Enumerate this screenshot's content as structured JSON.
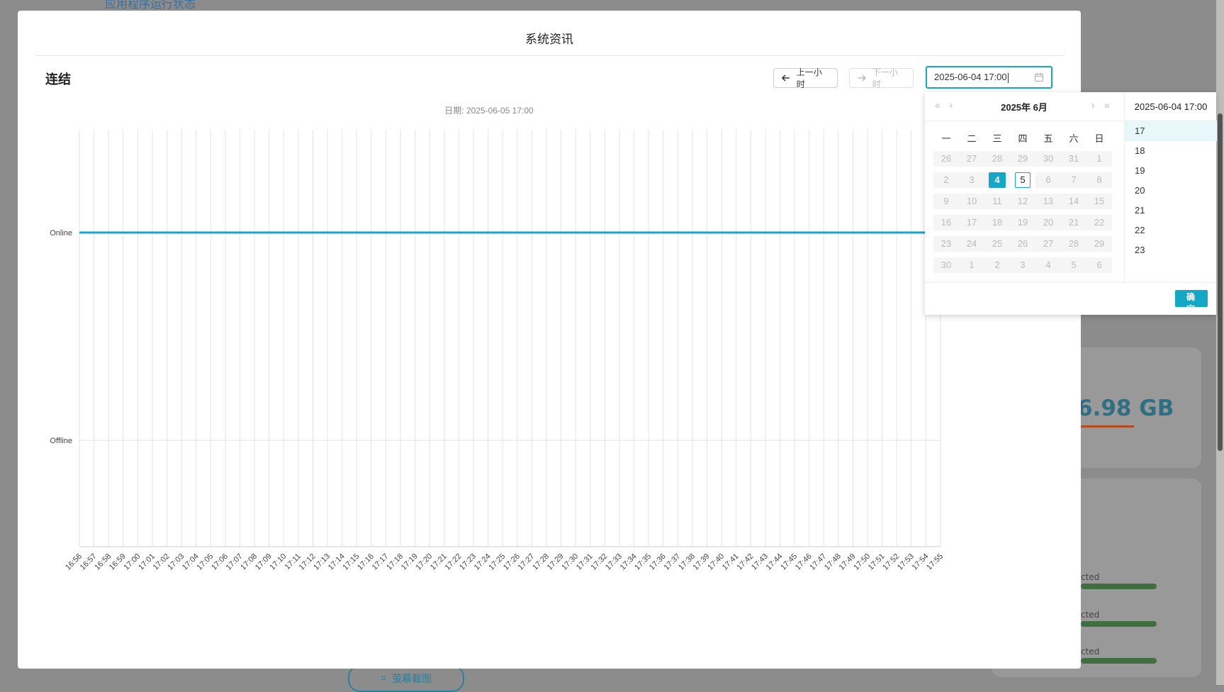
{
  "background": {
    "top_link": "应用程序运行状态",
    "storage_value": "6.98 GB",
    "status_texts": [
      "cted",
      "cted",
      "cted"
    ],
    "screenshot_button": "萤幕截图"
  },
  "modal": {
    "title": "系统资讯",
    "section_title": "连结",
    "prev_hour_label": "上一小时",
    "next_hour_label": "下一小时",
    "datetime_value": "2025-06-04 17:00"
  },
  "chart_data": {
    "type": "line",
    "title": "日期: 2025-06-05 17:00",
    "xlabel": "",
    "ylabel": "",
    "categories": [
      "16:56",
      "16:57",
      "16:58",
      "16:59",
      "17:00",
      "17:01",
      "17:02",
      "17:03",
      "17:04",
      "17:05",
      "17:06",
      "17:07",
      "17:08",
      "17:09",
      "17:10",
      "17:11",
      "17:12",
      "17:13",
      "17:14",
      "17:15",
      "17:16",
      "17:17",
      "17:18",
      "17:19",
      "17:20",
      "17:21",
      "17:22",
      "17:23",
      "17:24",
      "17:25",
      "17:26",
      "17:27",
      "17:28",
      "17:29",
      "17:30",
      "17:31",
      "17:32",
      "17:33",
      "17:34",
      "17:35",
      "17:36",
      "17:37",
      "17:38",
      "17:39",
      "17:40",
      "17:41",
      "17:42",
      "17:43",
      "17:44",
      "17:45",
      "17:46",
      "17:47",
      "17:48",
      "17:49",
      "17:50",
      "17:51",
      "17:52",
      "17:53",
      "17:54",
      "17:55"
    ],
    "y_levels": [
      "Online",
      "Offline"
    ],
    "series": [
      {
        "values": [
          "Online",
          "Online",
          "Online",
          "Online",
          "Online",
          "Online",
          "Online",
          "Online",
          "Online",
          "Online",
          "Online",
          "Online",
          "Online",
          "Online",
          "Online",
          "Online",
          "Online",
          "Online",
          "Online",
          "Online",
          "Online",
          "Online",
          "Online",
          "Online",
          "Online",
          "Online",
          "Online",
          "Online",
          "Online",
          "Online",
          "Online",
          "Online",
          "Online",
          "Online",
          "Online",
          "Online",
          "Online",
          "Online",
          "Online",
          "Online",
          "Online",
          "Online",
          "Online",
          "Online",
          "Online",
          "Online",
          "Online",
          "Online",
          "Online",
          "Online",
          "Online",
          "Online",
          "Online",
          "Online",
          "Online",
          "Online",
          "Online",
          "Online",
          "Online",
          "Online"
        ],
        "color": "#14a8c6"
      }
    ],
    "grid": true
  },
  "picker": {
    "year_month": "2025年  6月",
    "weekdays": [
      "一",
      "二",
      "三",
      "四",
      "五",
      "六",
      "日"
    ],
    "weeks": [
      [
        "26",
        "27",
        "28",
        "29",
        "30",
        "31",
        "1"
      ],
      [
        "2",
        "3",
        "4",
        "5",
        "6",
        "7",
        "8"
      ],
      [
        "9",
        "10",
        "11",
        "12",
        "13",
        "14",
        "15"
      ],
      [
        "16",
        "17",
        "18",
        "19",
        "20",
        "21",
        "22"
      ],
      [
        "23",
        "24",
        "25",
        "26",
        "27",
        "28",
        "29"
      ],
      [
        "30",
        "1",
        "2",
        "3",
        "4",
        "5",
        "6"
      ]
    ],
    "selected_day": "4",
    "today_day": "5",
    "time_header": "2025-06-04 17:00",
    "hours": [
      "17",
      "18",
      "19",
      "20",
      "21",
      "22",
      "23"
    ],
    "active_hour": "17",
    "ok_label": "确 定"
  },
  "colors": {
    "accent": "#14a8c6",
    "online_line": "#14a8c6"
  }
}
